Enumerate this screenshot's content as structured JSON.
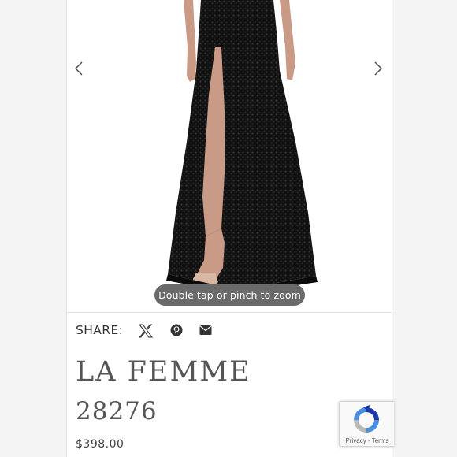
{
  "product": {
    "gallery": {
      "zoom_hint": "Double tap or pinch to zoom",
      "prev_icon": "chevron-left-icon",
      "next_icon": "chevron-right-icon",
      "image_description_icon": "black-sequin-gown-photo"
    },
    "share": {
      "label": "SHARE:",
      "icons": [
        "x-twitter-icon",
        "pinterest-icon",
        "email-icon"
      ]
    },
    "brand": "LA FEMME",
    "style_number": "28276",
    "price": "$398.00"
  },
  "recaptcha": {
    "privacy": "Privacy",
    "separator": " - ",
    "terms": "Terms"
  },
  "colors": {
    "text": "#555555",
    "zoom_pill": "#6a6a6a",
    "dress": "#141414"
  }
}
